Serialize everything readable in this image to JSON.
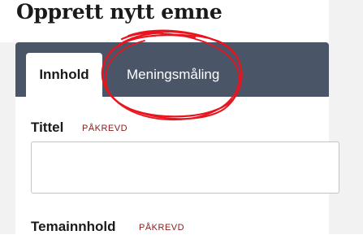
{
  "page": {
    "title": "Opprett nytt emne"
  },
  "tabs": [
    {
      "label": "Innhold",
      "active": true
    },
    {
      "label": "Meningsmåling",
      "active": false
    }
  ],
  "form": {
    "title_field": {
      "label": "Tittel",
      "required_label": "PÅKREVD",
      "value": ""
    },
    "content_field": {
      "label": "Temainnhold",
      "required_label": "PÅKREVD"
    }
  },
  "colors": {
    "tab_bar": "#4a5568",
    "required": "#8b1a1a",
    "annotation": "#e8141e"
  }
}
